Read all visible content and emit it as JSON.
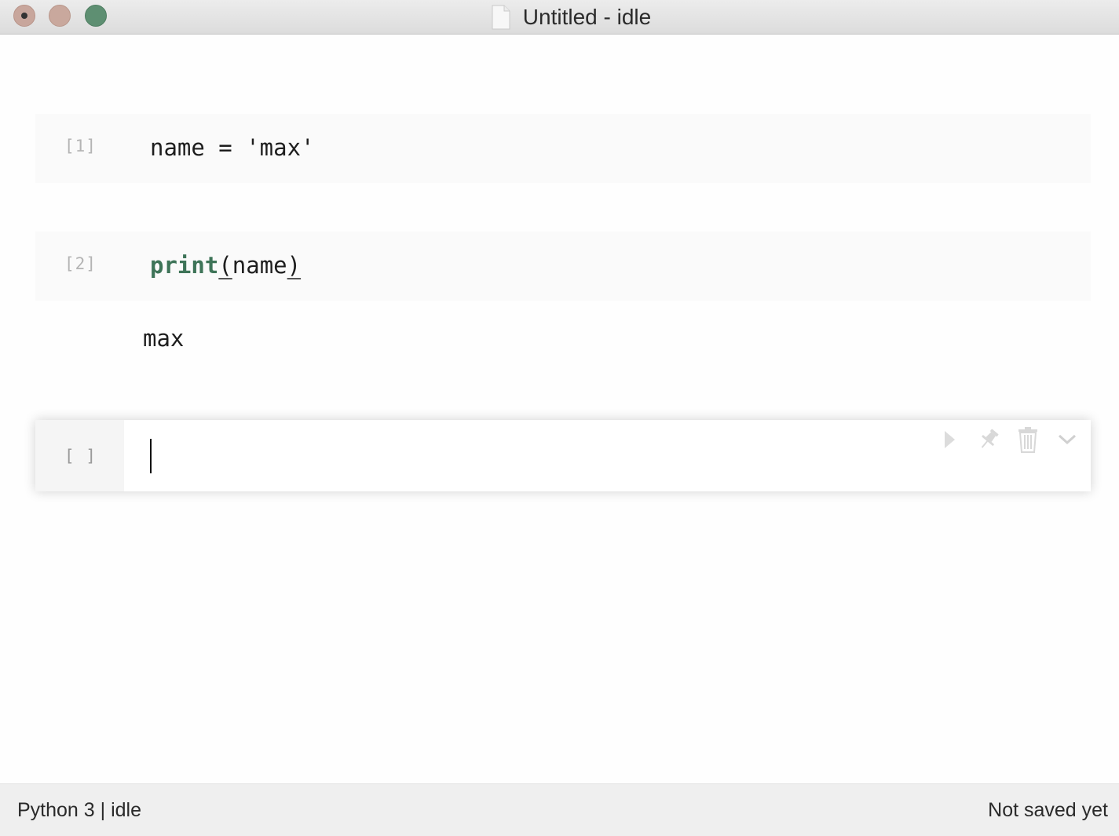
{
  "window": {
    "title": "Untitled - idle"
  },
  "cells": [
    {
      "prompt": "[1]",
      "code": "name = 'max'"
    },
    {
      "prompt": "[2]",
      "code_keyword": "print",
      "code_open": "(",
      "code_arg": "name",
      "code_close": ")",
      "output": "max"
    },
    {
      "prompt": "[ ]",
      "code": ""
    }
  ],
  "cell_tools": {
    "run": "play-icon",
    "pin": "pin-icon",
    "delete": "trash-icon",
    "more": "chevron-down-icon"
  },
  "status": {
    "kernel": "Python 3 | idle",
    "save_state": "Not saved yet"
  },
  "colors": {
    "keyword": "#3e7458",
    "close": "#c8a69c",
    "minimize": "#c9a89d",
    "zoom": "#5e8f72"
  }
}
